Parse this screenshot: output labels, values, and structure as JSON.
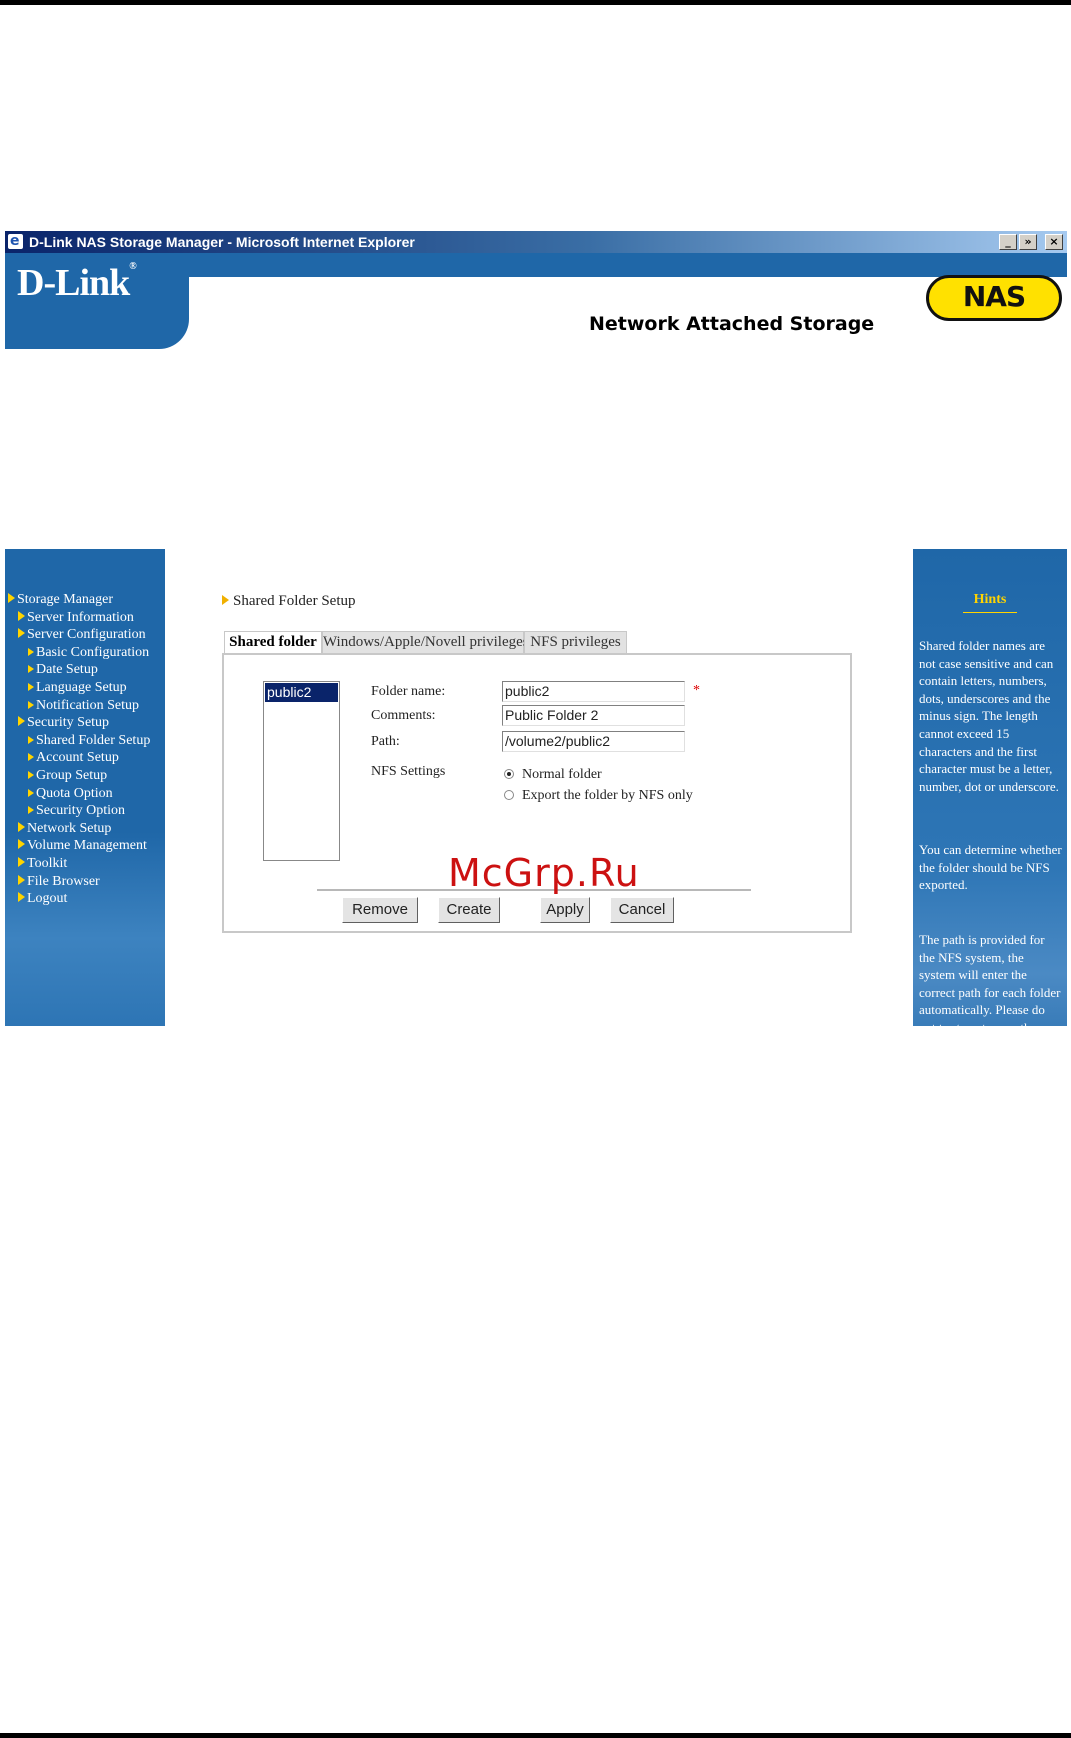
{
  "window": {
    "title": "D-Link NAS Storage Manager - Microsoft Internet Explorer",
    "controls": {
      "minimize": "_",
      "maximize": "»",
      "close": "×"
    }
  },
  "header": {
    "logo": "D-Link",
    "logo_mark": "®",
    "badge": "NAS",
    "tagline": "Network Attached Storage"
  },
  "sidebar": {
    "items": [
      {
        "label": "Storage Manager",
        "level": 1
      },
      {
        "label": "Server Information",
        "level": 2
      },
      {
        "label": "Server Configuration",
        "level": 2
      },
      {
        "label": "Basic Configuration",
        "level": 3
      },
      {
        "label": "Date Setup",
        "level": 3
      },
      {
        "label": "Language Setup",
        "level": 3
      },
      {
        "label": "Notification Setup",
        "level": 3
      },
      {
        "label": "Security Setup",
        "level": 2
      },
      {
        "label": "Shared Folder Setup",
        "level": 3
      },
      {
        "label": "Account Setup",
        "level": 3
      },
      {
        "label": "Group Setup",
        "level": 3
      },
      {
        "label": "Quota Option",
        "level": 3
      },
      {
        "label": "Security Option",
        "level": 3
      },
      {
        "label": "Network Setup",
        "level": 2
      },
      {
        "label": "Volume Management",
        "level": 2
      },
      {
        "label": "Toolkit",
        "level": 2
      },
      {
        "label": "File Browser",
        "level": 2
      },
      {
        "label": "Logout",
        "level": 2
      }
    ]
  },
  "main": {
    "breadcrumb": "Shared Folder Setup",
    "tabs": [
      {
        "label": "Shared folder",
        "active": true
      },
      {
        "label": "Windows/Apple/Novell privileges",
        "active": false
      },
      {
        "label": "NFS privileges",
        "active": false
      }
    ],
    "folder_list": {
      "selected": "public2"
    },
    "form": {
      "folder_name": {
        "label": "Folder name:",
        "value": "public2",
        "required_mark": "*"
      },
      "comments": {
        "label": "Comments:",
        "value": "Public Folder 2"
      },
      "path": {
        "label": "Path:",
        "value": "/volume2/public2"
      },
      "nfs": {
        "label": "NFS Settings",
        "options": [
          {
            "label": "Normal folder",
            "checked": true
          },
          {
            "label": "Export the folder by NFS only",
            "checked": false
          }
        ]
      }
    },
    "buttons": {
      "remove": "Remove",
      "create": "Create",
      "apply": "Apply",
      "cancel": "Cancel"
    }
  },
  "hints": {
    "title": "Hints",
    "paragraphs": [
      "Shared folder names are not case sensitive and can contain letters, numbers, dots, underscores and the minus sign. The length cannot exceed 15 characters and the first character must be a letter, number, dot or underscore.",
      "You can determine whether the folder should be NFS exported.",
      "The path is provided for the NFS system, the system will enter the correct path for each folder automatically. Please do not try to enter a path manually."
    ]
  },
  "watermark": "McGrp.Ru",
  "colors": {
    "brand_blue": "#1f67a8",
    "accent_yellow": "#ffd400",
    "selection": "#0a246a",
    "watermark_red": "#cc1111"
  }
}
